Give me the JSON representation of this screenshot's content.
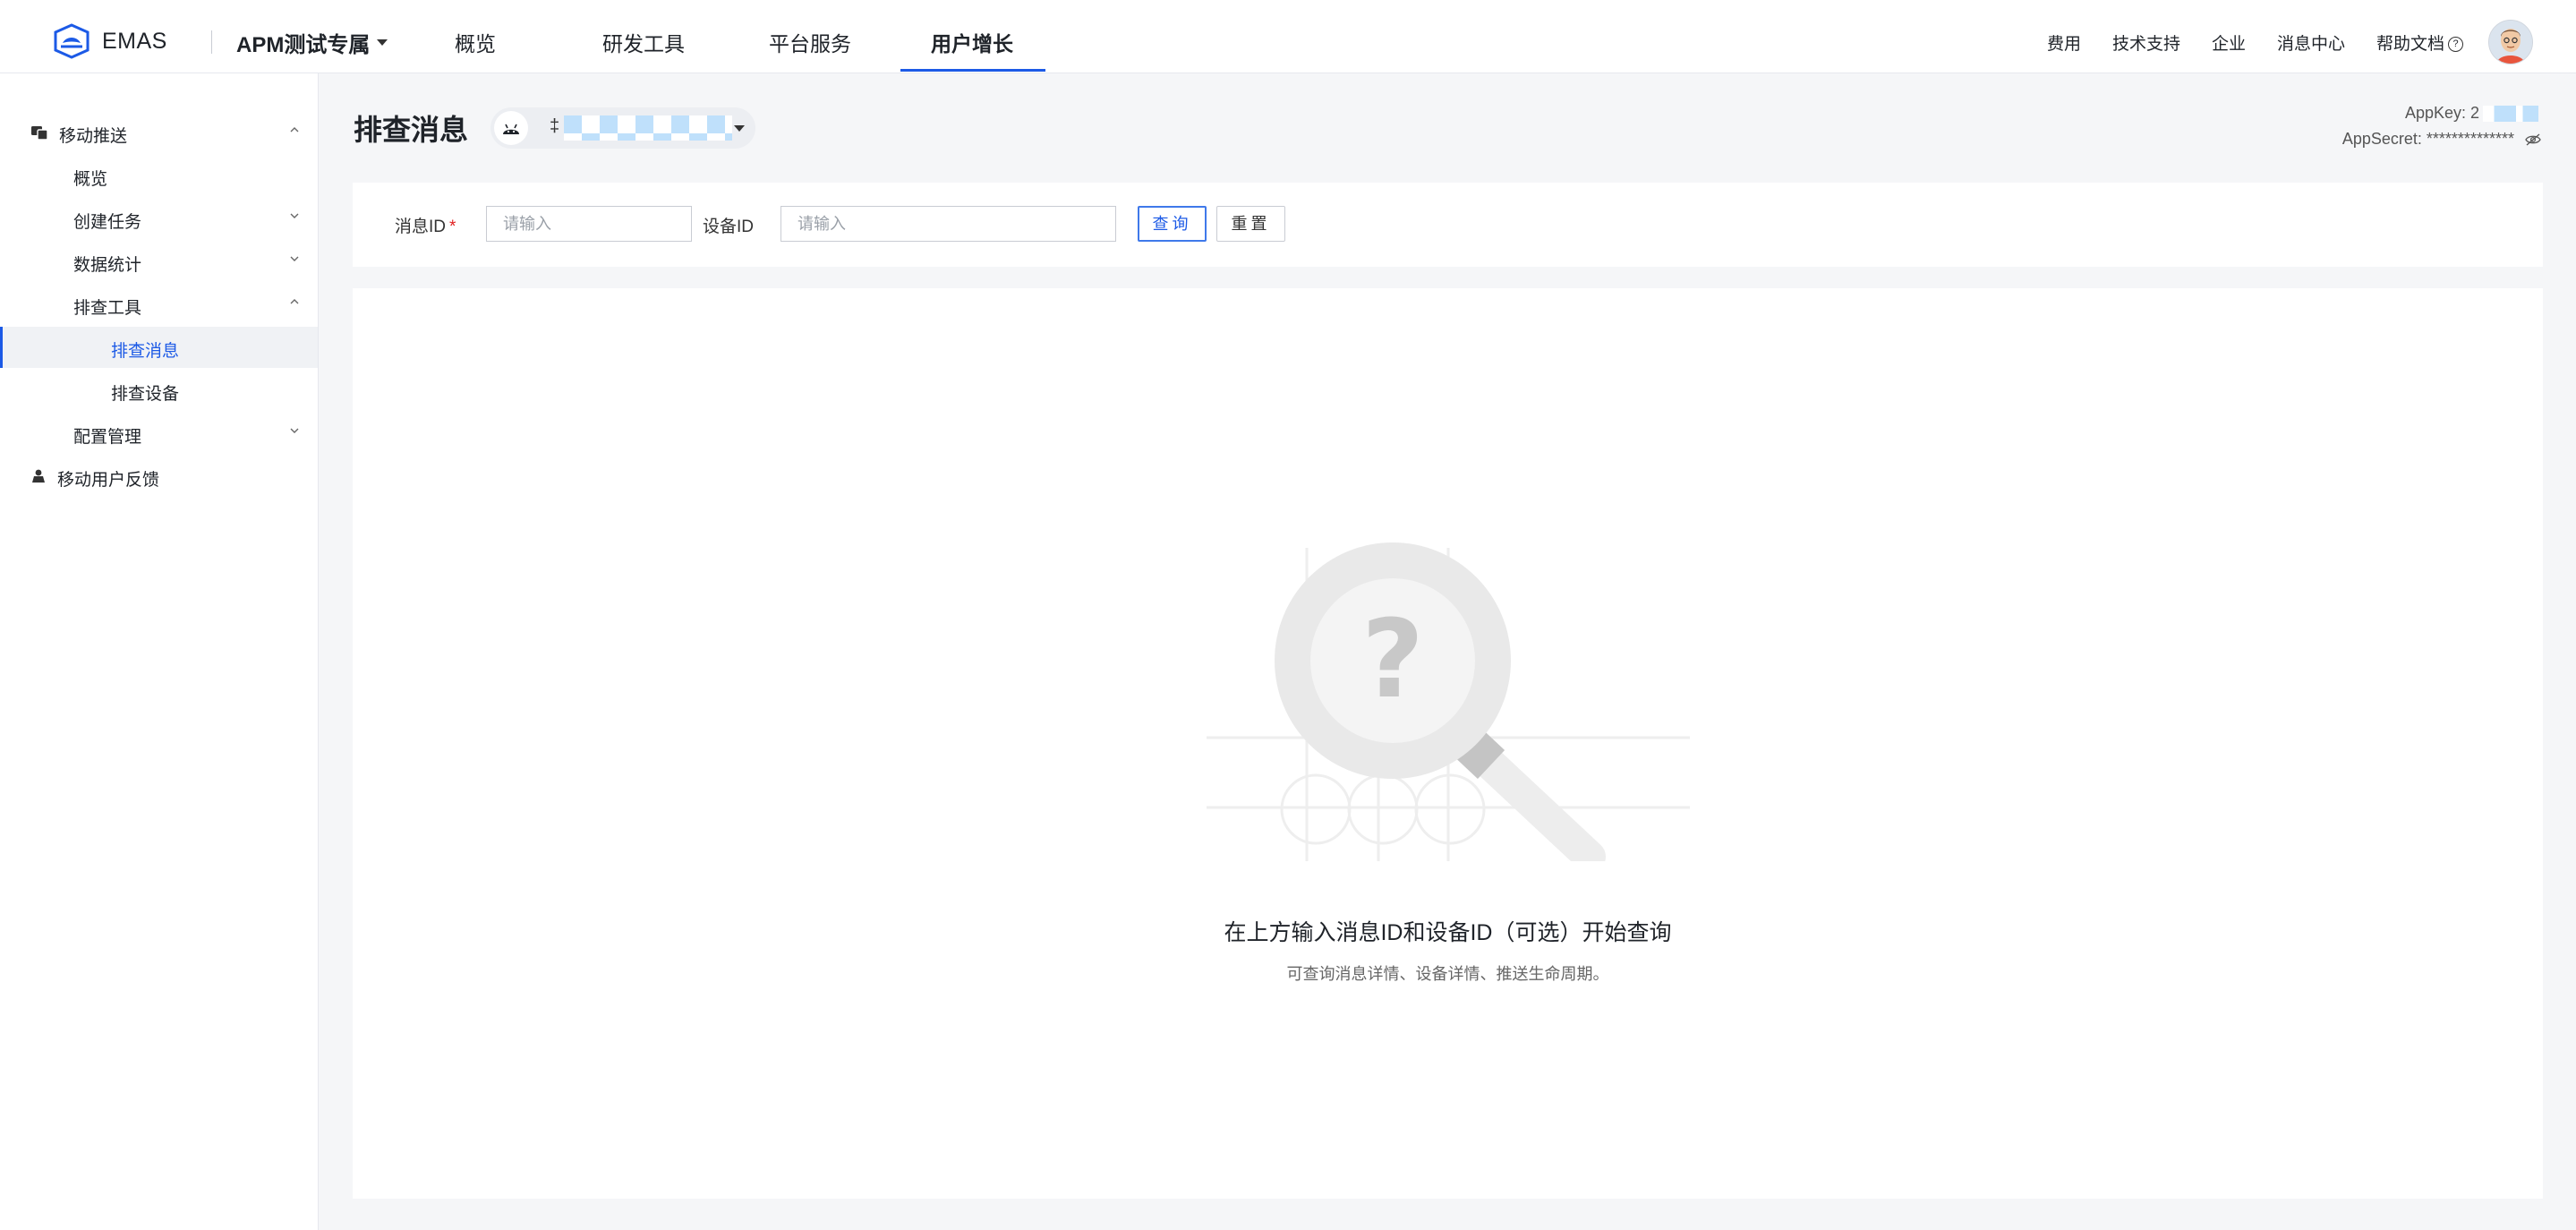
{
  "topbar": {
    "brand": "EMAS",
    "project": "APM测试专属",
    "nav": [
      {
        "label": "概览"
      },
      {
        "label": "研发工具"
      },
      {
        "label": "平台服务"
      },
      {
        "label": "用户增长",
        "active": true
      }
    ],
    "right_links": [
      "费用",
      "技术支持",
      "企业",
      "消息中心",
      "帮助文档"
    ],
    "accent_color": "#1c5ae6"
  },
  "sidebar": {
    "items": [
      {
        "label": "移动推送",
        "icon": "push-icon"
      },
      {
        "label": "概览"
      },
      {
        "label": "创建任务"
      },
      {
        "label": "数据统计"
      },
      {
        "label": "排查工具"
      },
      {
        "label": "排查消息",
        "selected": true
      },
      {
        "label": "排查设备"
      },
      {
        "label": "配置管理"
      },
      {
        "label": "移动用户反馈",
        "icon": "feedback-icon"
      }
    ]
  },
  "header": {
    "title": "排查消息",
    "app_name_visible": "‡",
    "appkey_label": "AppKey: 2",
    "appsecret_label": "AppSecret: ",
    "appsecret_value": "**************"
  },
  "search": {
    "message_id_label": "消息ID",
    "required_mark": "*",
    "message_id_placeholder": "请输入",
    "device_id_label": "设备ID",
    "device_id_placeholder": "请输入",
    "query_button": "查询",
    "reset_button": "重置"
  },
  "empty_state": {
    "title": "在上方输入消息ID和设备ID（可选）开始查询",
    "subtitle": "可查询消息详情、设备详情、推送生命周期。"
  }
}
